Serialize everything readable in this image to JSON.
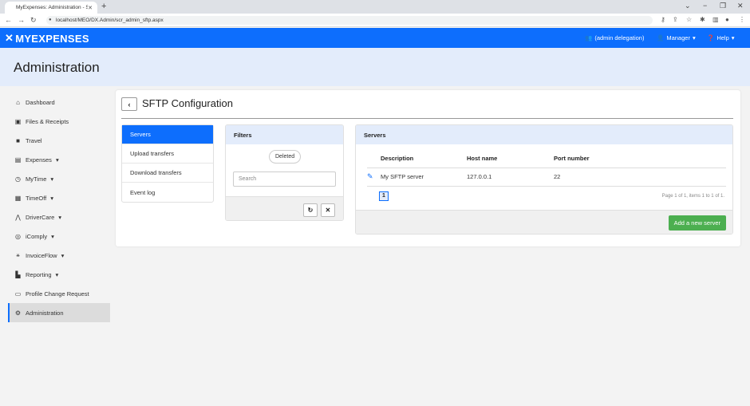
{
  "browser": {
    "tab_title": "MyExpenses: Administration - SF",
    "tab_close": "✕",
    "new_tab": "+",
    "url": "localhost/MEO/DX.Admin/scr_admin_sftp.aspx"
  },
  "header": {
    "brand": "MYEXPENSES",
    "delegation": "(admin delegation)",
    "user": "Manager",
    "help": "Help"
  },
  "page": {
    "title": "Administration"
  },
  "sidebar": {
    "items": [
      {
        "label": "Dashboard",
        "icon": "home-icon"
      },
      {
        "label": "Files & Receipts",
        "icon": "image-icon"
      },
      {
        "label": "Travel",
        "icon": "suitcase-icon"
      },
      {
        "label": "Expenses",
        "icon": "calculator-icon",
        "dropdown": true
      },
      {
        "label": "MyTime",
        "icon": "clock-icon",
        "dropdown": true
      },
      {
        "label": "TimeOff",
        "icon": "calendar-icon",
        "dropdown": true
      },
      {
        "label": "DriverCare",
        "icon": "road-icon",
        "dropdown": true
      },
      {
        "label": "iComply",
        "icon": "compliance-icon",
        "dropdown": true
      },
      {
        "label": "InvoiceFlow",
        "icon": "invoice-flow-icon",
        "dropdown": true
      },
      {
        "label": "Reporting",
        "icon": "report-icon",
        "dropdown": true
      },
      {
        "label": "Profile Change Request",
        "icon": "inbox-icon"
      },
      {
        "label": "Administration",
        "icon": "cogs-icon",
        "active": true
      }
    ]
  },
  "content": {
    "title": "SFTP Configuration",
    "back": "‹"
  },
  "menu": {
    "items": [
      "Servers",
      "Upload transfers",
      "Download transfers",
      "Event log"
    ]
  },
  "filters": {
    "title": "Filters",
    "chip": "Deleted",
    "search_placeholder": "Search"
  },
  "servers": {
    "title": "Servers",
    "columns": [
      "Description",
      "Host name",
      "Port number"
    ],
    "rows": [
      {
        "description": "My SFTP server",
        "host": "127.0.0.1",
        "port": "22"
      }
    ],
    "page": "1",
    "paging_text": "Page 1 of 1, items 1 to 1 of 1.",
    "add_button": "Add a new server"
  },
  "colors": {
    "brand_blue": "#0d6efd",
    "light_blue": "#e3ecfb",
    "green": "#4caf50"
  }
}
